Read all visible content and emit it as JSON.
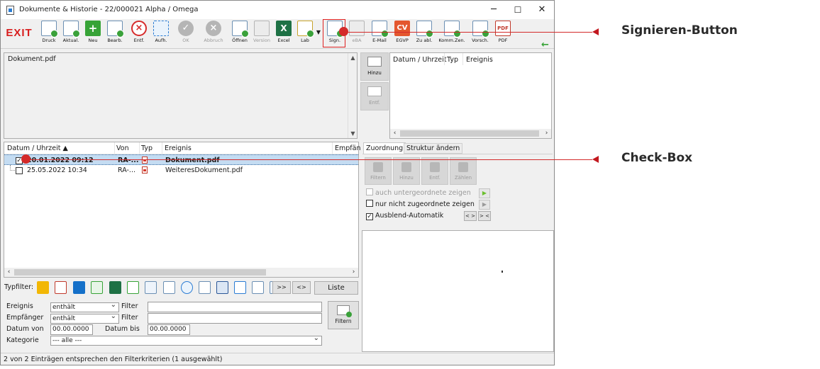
{
  "window": {
    "title": "Dokumente & Historie - 22/000021 Alpha / Omega",
    "controls": {
      "minimize": "─",
      "maximize": "☐",
      "close": "✕"
    }
  },
  "toolbar": {
    "exit_label": "EXIT",
    "buttons": [
      {
        "label": "Druck",
        "icon": "printer-icon"
      },
      {
        "label": "Aktual.",
        "icon": "refresh-icon"
      },
      {
        "label": "Neu",
        "icon": "new-icon"
      },
      {
        "label": "Bearb.",
        "icon": "edit-icon"
      },
      {
        "label": "Entf.",
        "icon": "delete-icon"
      },
      {
        "label": "Aufh.",
        "icon": "hierarchy-icon"
      },
      {
        "label": "OK",
        "icon": "check-icon"
      },
      {
        "label": "Abbruch",
        "icon": "cancel-icon"
      },
      {
        "label": "Öffnen",
        "icon": "open-icon"
      },
      {
        "label": "Version",
        "icon": "version-icon"
      },
      {
        "label": "Excel",
        "icon": "excel-icon"
      },
      {
        "label": "Lab",
        "icon": "lab-icon"
      },
      {
        "label": "Sign.",
        "icon": "sign-icon"
      },
      {
        "label": "eBA",
        "icon": "eba-icon"
      },
      {
        "label": "E-Mail",
        "icon": "email-icon"
      },
      {
        "label": "EGVP",
        "icon": "egvp-icon"
      },
      {
        "label": "Zu abl.",
        "icon": "archive-icon"
      },
      {
        "label": "Komm.Zen.",
        "icon": "communication-icon"
      },
      {
        "label": "Vorsch.",
        "icon": "preview-icon"
      },
      {
        "label": "PDF",
        "icon": "pdf-icon"
      }
    ]
  },
  "preview": {
    "filename": "Dokument.pdf"
  },
  "side_buttons": {
    "add_label": "Hinzu",
    "remove_label": "Entf."
  },
  "history_table": {
    "columns": [
      "Datum / Uhrzeit",
      "Typ",
      "Ereignis"
    ]
  },
  "document_list": {
    "columns": [
      "Datum / Uhrzeit ▲",
      "Von",
      "Typ",
      "Ereignis",
      "Empfän"
    ],
    "rows": [
      {
        "datetime": "20.01.2022 09:12",
        "from": "RA-...",
        "event": "Dokument.pdf",
        "checked": "✓"
      },
      {
        "datetime": "25.05.2022 10:34",
        "from": "RA-...",
        "event": "WeiteresDokument.pdf",
        "checked": ""
      }
    ]
  },
  "typfilter": {
    "label": "Typfilter:",
    "btn1": ">>",
    "btn2": "<>",
    "liste_label": "Liste"
  },
  "filters": {
    "ereignis_label": "Ereignis",
    "ereignis_op": "enthält",
    "empfaenger_label": "Empfänger",
    "empfaenger_op": "enthält",
    "filter_label": "Filter",
    "datum_von_label": "Datum von",
    "datum_von_value": "00.00.0000",
    "datum_bis_label": "Datum bis",
    "datum_bis_value": "00.00.0000",
    "kategorie_label": "Kategorie",
    "kategorie_value": "--- alle ---",
    "filtern_label": "Filtern"
  },
  "status": "2 von 2 Einträgen entsprechen den Filterkriterien (1 ausgewählt)",
  "assign_panel": {
    "tabs": [
      "Zuordnung",
      "Struktur ändern"
    ],
    "buttons": [
      "Filtern",
      "Hinzu",
      "Entf.",
      "Zählen"
    ],
    "options": [
      {
        "label": "auch untergeordnete zeigen",
        "checked": "",
        "disabled": true
      },
      {
        "label": "nur nicht zugeordnete zeigen",
        "checked": ""
      },
      {
        "label": "Ausblend-Automatik",
        "checked": "✓"
      }
    ],
    "play": "▶",
    "mini_btns": [
      "< >",
      "> <"
    ]
  },
  "annotations": {
    "sign_label": "Signieren-Button",
    "checkbox_label": "Check-Box"
  },
  "colors": {
    "callout": "#d42a2a",
    "exit": "#d81e1e",
    "selection": "#c4dcf2"
  }
}
